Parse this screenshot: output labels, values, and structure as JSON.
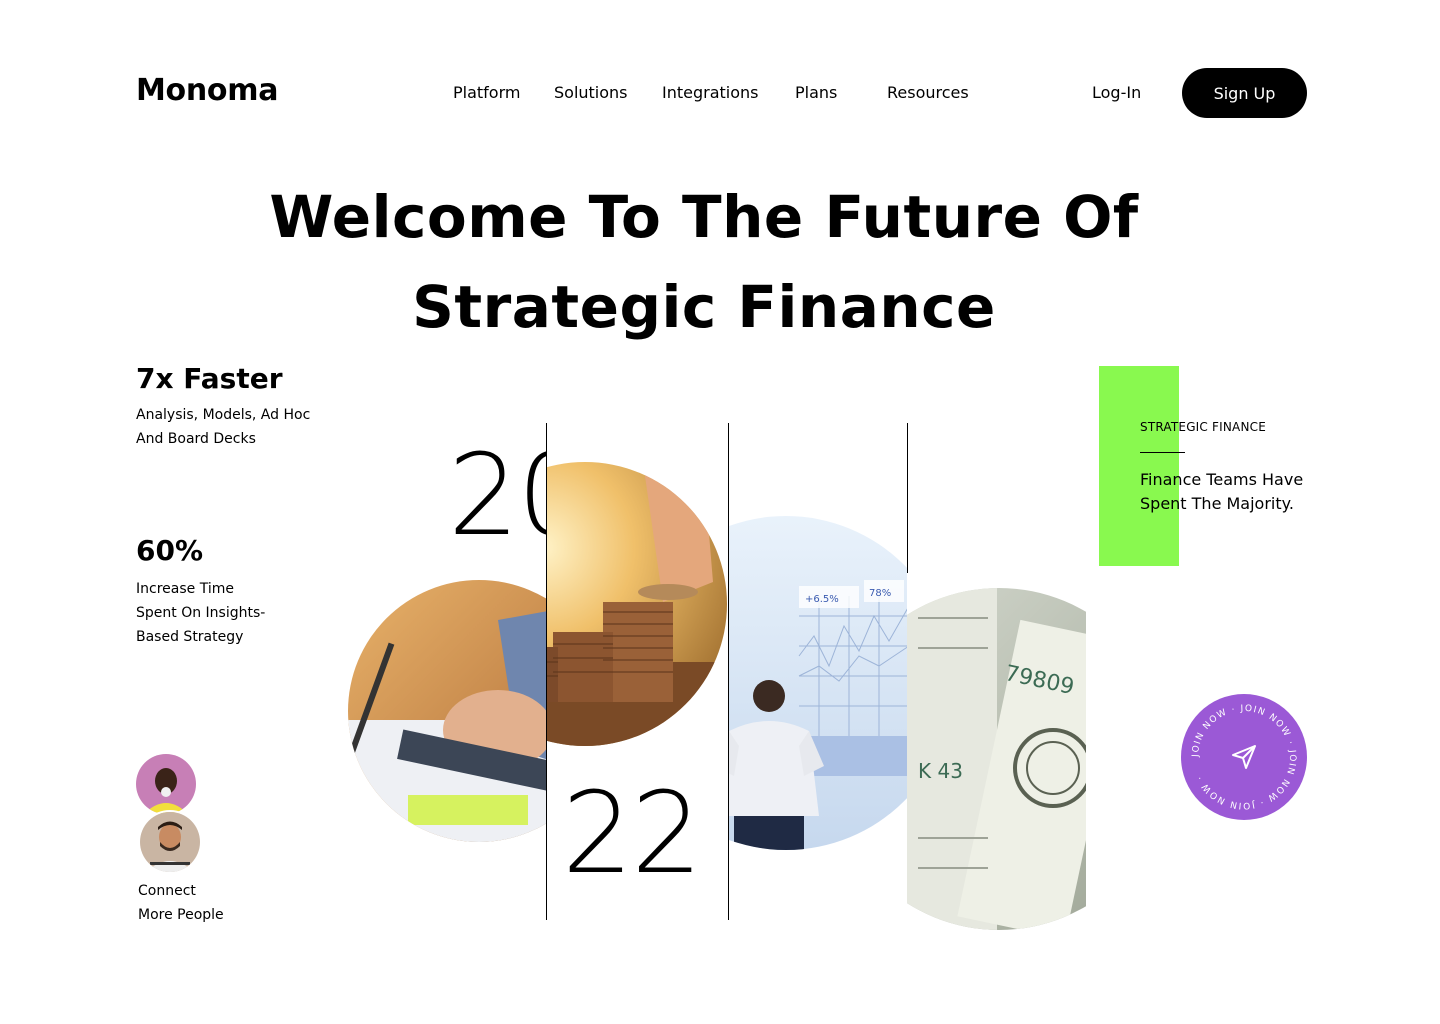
{
  "brand": {
    "name": "Monoma"
  },
  "nav": {
    "items": [
      {
        "label": "Platform"
      },
      {
        "label": "Solutions"
      },
      {
        "label": "Integrations"
      },
      {
        "label": "Plans"
      },
      {
        "label": "Resources"
      }
    ],
    "login_label": "Log-In",
    "signup_label": "Sign Up"
  },
  "hero": {
    "line1": "Welcome To The Future Of",
    "line2": "Strategic Finance"
  },
  "stats": [
    {
      "title": "7x Faster",
      "desc_line1": "Analysis, Models, Ad Hoc",
      "desc_line2": "And Board Decks"
    },
    {
      "title": "60%",
      "desc_line1": "Increase Time",
      "desc_line2": "Spent On Insights-",
      "desc_line3": "Based Strategy"
    }
  ],
  "connect": {
    "line1": "Connect",
    "line2": "More People"
  },
  "year": {
    "part1": "20",
    "part2": "22"
  },
  "side_card": {
    "label": "STRATEGIC FINANCE",
    "text_line1": "Finance Teams Have",
    "text_line2": "Spent The Majority."
  },
  "join_badge": {
    "ring_text": "JOIN NOW · JOIN NOW · JOIN NOW · JOIN NOW · "
  },
  "chart_overlay": {
    "pct1": "+6.5%",
    "pct2": "78%"
  },
  "colors": {
    "accent_green": "#89f94f",
    "accent_purple": "#9b59d6",
    "primary": "#000000"
  },
  "icons": {
    "join": "send-arrow-icon"
  }
}
